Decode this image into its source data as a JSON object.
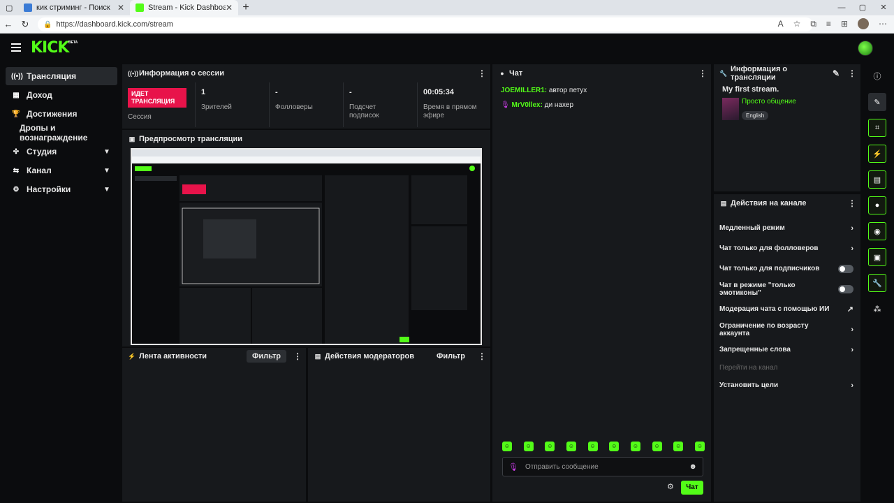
{
  "browser": {
    "tabs": [
      {
        "title": "кик стриминг - Поиск",
        "active": false
      },
      {
        "title": "Stream - Kick Dashboard",
        "active": true
      }
    ],
    "new_tab": "+",
    "url": "https://dashboard.kick.com/stream"
  },
  "header": {
    "logo": "KICK",
    "beta": "BETA"
  },
  "sidebar": {
    "items": [
      {
        "label": "Трансляция",
        "icon": "broadcast-icon",
        "active": true
      },
      {
        "label": "Доход",
        "icon": "money-icon"
      },
      {
        "label": "Достижения",
        "icon": "trophy-icon"
      },
      {
        "label": "Дропы и вознаграждение",
        "sub": true
      },
      {
        "label": "Студия",
        "icon": "studio-icon",
        "chevron": true
      },
      {
        "label": "Канал",
        "icon": "channel-icon",
        "chevron": true
      },
      {
        "label": "Настройки",
        "icon": "settings-icon",
        "chevron": true
      }
    ]
  },
  "session": {
    "title": "Информация о сессии",
    "live_badge": "ИДЕТ ТРАНСЛЯЦИЯ",
    "live_caption": "Сессия",
    "viewers_value": "1",
    "viewers_label": "Зрителей",
    "followers_value": "-",
    "followers_label": "Фолловеры",
    "subs_value": "-",
    "subs_label": "Подсчет подписок",
    "time_value": "00:05:34",
    "time_label": "Время в прямом эфире"
  },
  "preview": {
    "title": "Предпросмотр трансляции"
  },
  "activity": {
    "title": "Лента активности",
    "filter": "Фильтр"
  },
  "mod_actions": {
    "title": "Действия модераторов",
    "filter": "Фильтр"
  },
  "chat": {
    "title": "Чат",
    "messages": [
      {
        "user": "JOEMILLER1:",
        "text": " автор петух"
      },
      {
        "user": "MrV0llex:",
        "text": " ди нахер"
      }
    ],
    "placeholder": "Отправить сообщение",
    "send": "Чат"
  },
  "stream_info": {
    "title": "Информация о трансляции",
    "stream_title": "My first stream.",
    "category": "Просто общение",
    "language": "English"
  },
  "channel_actions": {
    "title": "Действия на канале",
    "items": [
      {
        "label": "Медленный режим",
        "control": "chevron"
      },
      {
        "label": "Чат только для фолловеров",
        "control": "chevron"
      },
      {
        "label": "Чат только для подписчиков",
        "control": "toggle"
      },
      {
        "label": "Чат в режиме \"только эмотиконы\"",
        "control": "toggle"
      },
      {
        "label": "Модерация чата с помощью ИИ",
        "control": "external"
      },
      {
        "label": "Ограничение по возрасту аккаунта",
        "control": "chevron"
      },
      {
        "label": "Запрещенные слова",
        "control": "chevron"
      }
    ],
    "go_to_channel": "Перейти на канал",
    "set_goals": "Установить цели"
  },
  "colors": {
    "accent": "#53fc18",
    "live": "#e8134a",
    "panel": "#17191c"
  }
}
